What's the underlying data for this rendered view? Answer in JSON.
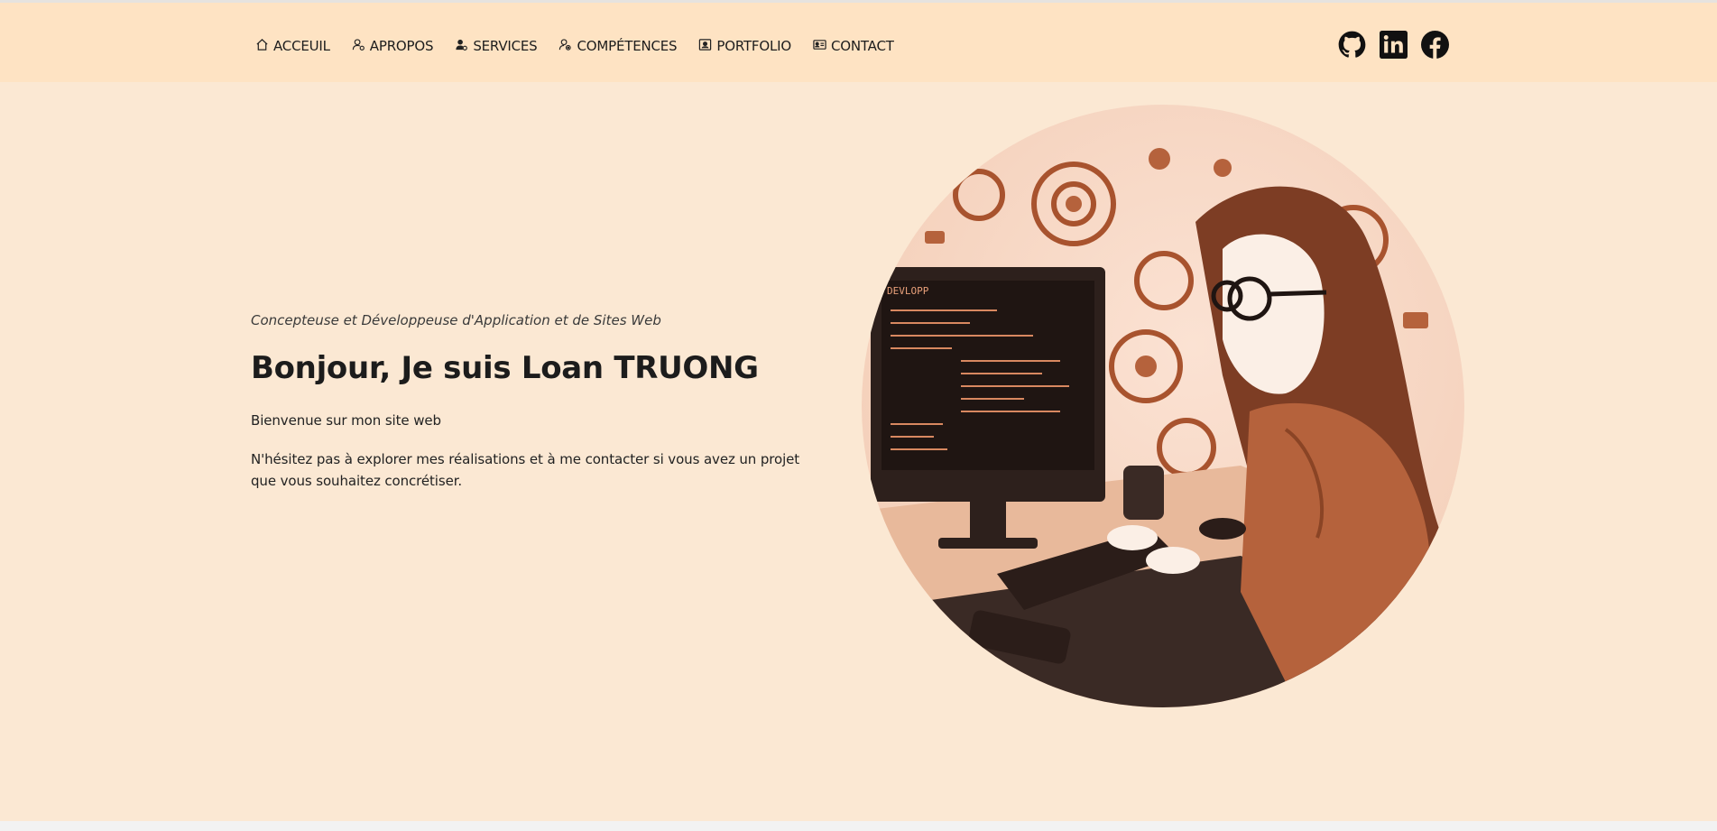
{
  "nav": {
    "items": [
      {
        "label": "ACCEUIL",
        "icon": "home-icon"
      },
      {
        "label": "APROPOS",
        "icon": "user-gear-icon"
      },
      {
        "label": "SERVICES",
        "icon": "user-gear-filled-icon"
      },
      {
        "label": "COMPÉTENCES",
        "icon": "user-cog-icon"
      },
      {
        "label": "PORTFOLIO",
        "icon": "portrait-icon"
      },
      {
        "label": "CONTACT",
        "icon": "contact-card-icon"
      }
    ],
    "social": [
      {
        "icon": "github-icon"
      },
      {
        "icon": "linkedin-icon"
      },
      {
        "icon": "facebook-icon"
      }
    ]
  },
  "hero": {
    "subtitle": "Concepteuse et Développeuse d'Application et de Sites Web",
    "title": "Bonjour, Je suis Loan TRUONG",
    "paragraph1": "Bienvenue sur mon site web",
    "paragraph2": "N'hésitez pas à explorer mes réalisations et à me contacter si vous avez un projet que vous souhaitez concrétiser.",
    "monitor_header": "DEVLOPP"
  },
  "colors": {
    "navbar_bg": "#fee3c3",
    "hero_bg": "#fbe8d3",
    "accent": "#b5623c"
  }
}
